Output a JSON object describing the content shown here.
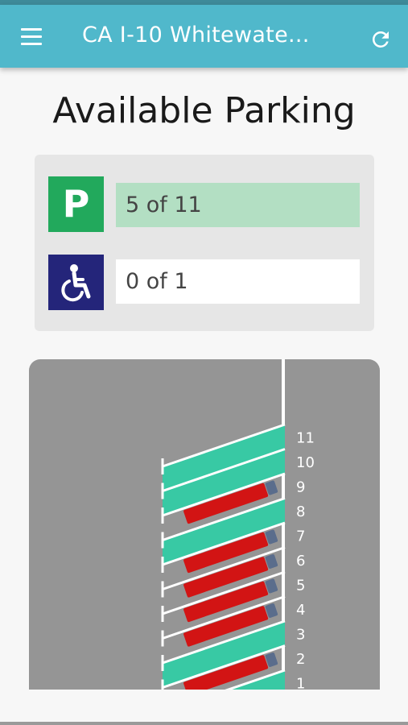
{
  "header": {
    "title": "CA I-10 Whitewate...",
    "menu_icon": "hamburger-menu-icon",
    "refresh_icon": "refresh-icon"
  },
  "page": {
    "heading": "Available Parking"
  },
  "availability": {
    "general": {
      "icon": "parking-p-icon",
      "icon_label": "P",
      "text": "5 of 11",
      "color": "#22a95c",
      "fill": "#b3dfc3"
    },
    "accessible": {
      "icon": "wheelchair-icon",
      "text": "0 of 1",
      "color": "#24257a"
    }
  },
  "lot": {
    "spaces": [
      {
        "label": "1",
        "occupied": false
      },
      {
        "label": "2",
        "occupied": true
      },
      {
        "label": "3",
        "occupied": false
      },
      {
        "label": "4",
        "occupied": true
      },
      {
        "label": "5",
        "occupied": true
      },
      {
        "label": "6",
        "occupied": true
      },
      {
        "label": "7",
        "occupied": true
      },
      {
        "label": "8",
        "occupied": false
      },
      {
        "label": "9",
        "occupied": true
      },
      {
        "label": "10",
        "occupied": false
      },
      {
        "label": "11",
        "occupied": false
      }
    ],
    "colors": {
      "open": "#38c9a4",
      "truck": "#d21414",
      "lot": "#959595",
      "lines": "#ffffff"
    }
  }
}
